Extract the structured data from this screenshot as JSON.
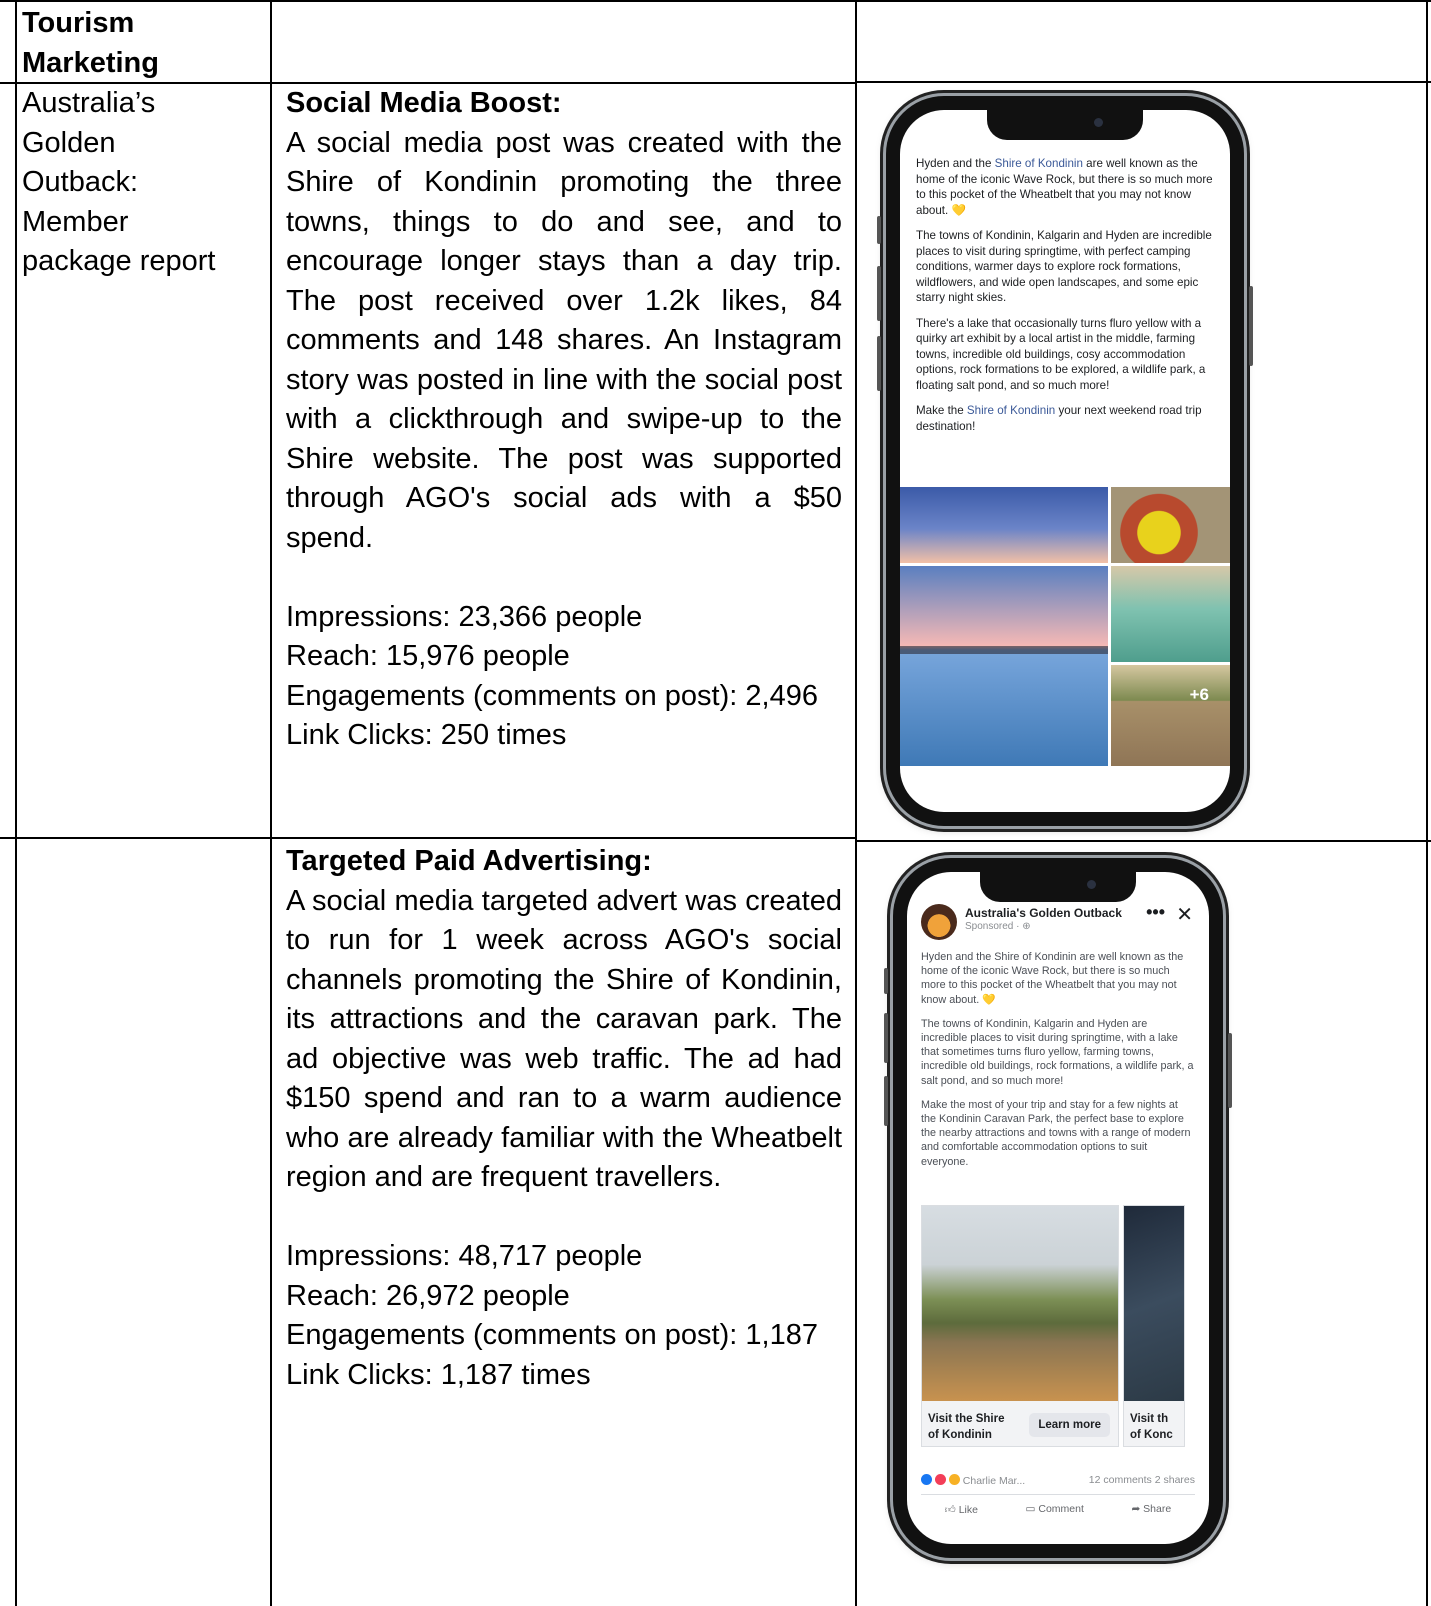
{
  "header": {
    "title_line1": "Tourism",
    "title_line2": "Marketing"
  },
  "row1": {
    "org_lines": [
      "Australia’s",
      "Golden",
      "Outback:",
      "Member",
      "package report"
    ],
    "heading": "Social Media Boost:",
    "body": "A social media post was created with the Shire of Kondinin promoting the three towns, things to do and see, and to encourage longer stays than a day trip. The post received over 1.2k likes, 84 comments and 148 shares. An Instagram story was posted in line with the social post with a clickthrough and swipe-up to the Shire website. The post was supported through AGO's social ads with a $50 spend.",
    "impressions": "Impressions: 23,366 people",
    "reach": "Reach: 15,976 people",
    "engagements": "Engagements (comments on post): 2,496",
    "link_clicks": "Link Clicks: 250 times"
  },
  "row2": {
    "heading": "Targeted Paid Advertising:",
    "body": "A social media targeted advert was created to run for 1 week across AGO's social channels promoting the Shire of Kondinin, its attractions and the caravan park. The ad objective was web traffic. The ad had $150 spend and ran to a warm audience who are already familiar with the Wheatbelt region and are frequent travellers.",
    "impressions": "Impressions: 48,717 people",
    "reach": "Reach: 26,972 people",
    "engagements": "Engagements (comments on post): 1,187",
    "link_clicks": "Link Clicks: 1,187 times"
  },
  "phone1": {
    "p1_a": "Hyden and the ",
    "p1_link": "Shire of Kondinin",
    "p1_b": " are well known as the home of the iconic Wave Rock, but there is so much more to this pocket of the Wheatbelt that you may not know about. ",
    "heart": "💛",
    "p2": "The towns of Kondinin, Kalgarin and Hyden are incredible places to visit during springtime, with perfect camping conditions, warmer days to explore rock formations, wildflowers, and wide open landscapes, and some epic starry night skies.",
    "p3": "There's a lake that occasionally turns fluro yellow with a quirky art exhibit by a local artist in the middle, farming towns, incredible old buildings, cosy accommodation options, rock formations to be explored, a wildlife park, a floating salt pond, and so much more!",
    "p4_a": "Make the ",
    "p4_link": "Shire of Kondinin",
    "p4_b": " your next weekend road trip destination!",
    "more_photos": "+6"
  },
  "phone2": {
    "page_name": "Australia's Golden Outback",
    "sponsored": "Sponsored · ⊕",
    "menu_dots": "•••",
    "close": "✕",
    "p1": "Hyden and the Shire of Kondinin are well known as the home of the iconic Wave Rock, but there is so much more to this pocket of the Wheatbelt that you may not know about. ",
    "heart": "💛",
    "p2": "The towns of Kondinin, Kalgarin and Hyden are incredible places to visit during springtime, with a lake that sometimes turns fluro yellow, farming towns, incredible old buildings, rock formations, a wildlife park, a salt pond, and so much more!",
    "p3": "Make the most of your trip and stay for a few nights at the Kondinin Caravan Park, the perfect base to explore the nearby attractions and towns with a range of modern and comfortable accommodation options to suit everyone.",
    "card1_title_l1": "Visit the Shire",
    "card1_title_l2": "of Kondinin",
    "card1_button": "Learn more",
    "card2_title_l1": "Visit th",
    "card2_title_l2": "of Konc",
    "reactions_name": "Charlie Mar...",
    "comments": "12 comments",
    "shares": "2 shares",
    "like": "Like",
    "comment": "Comment",
    "share": "Share"
  }
}
